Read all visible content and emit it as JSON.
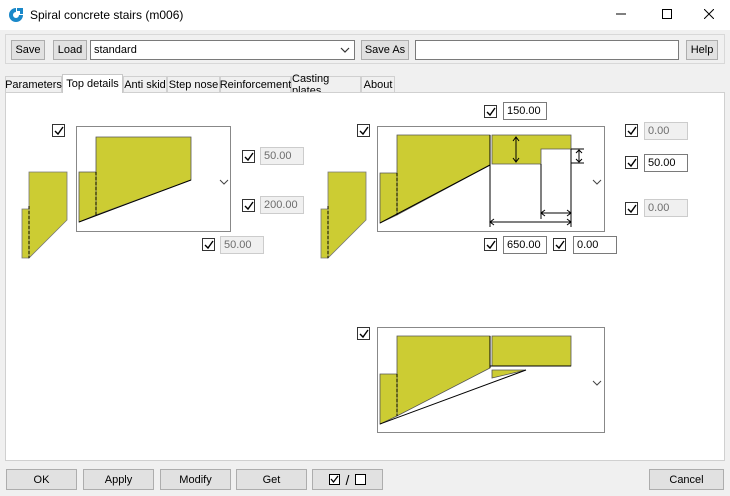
{
  "window": {
    "title": "Spiral concrete stairs (m006)",
    "app_icon": "app-logo-icon",
    "minimize_icon": "minimize-icon",
    "maximize_icon": "maximize-icon",
    "close_icon": "close-icon"
  },
  "toolbar": {
    "save_label": "Save",
    "load_label": "Load",
    "preset_value": "standard",
    "save_as_label": "Save As",
    "save_as_value": "",
    "help_label": "Help"
  },
  "tabs": [
    {
      "label": "Parameters",
      "active": false
    },
    {
      "label": "Top details",
      "active": true
    },
    {
      "label": "Anti skid",
      "active": false
    },
    {
      "label": "Step nose",
      "active": false
    },
    {
      "label": "Reinforcement",
      "active": false
    },
    {
      "label": "Casting plates",
      "active": false
    },
    {
      "label": "About",
      "active": false
    }
  ],
  "left_detail": {
    "value_top": "50.00",
    "value_mid": "200.00",
    "value_bottom": "50.00"
  },
  "right_detail": {
    "value_top": "150.00",
    "value_right_1": "0.00",
    "value_right_2": "50.00",
    "value_right_3": "0.00",
    "value_bottom_1": "650.00",
    "value_bottom_2": "0.00"
  },
  "colors": {
    "concrete_fill": "#cccc33",
    "accent_blue": "#1a88c9"
  },
  "bottom": {
    "ok_label": "OK",
    "apply_label": "Apply",
    "modify_label": "Modify",
    "get_label": "Get",
    "toggle_separator": "/",
    "cancel_label": "Cancel"
  }
}
